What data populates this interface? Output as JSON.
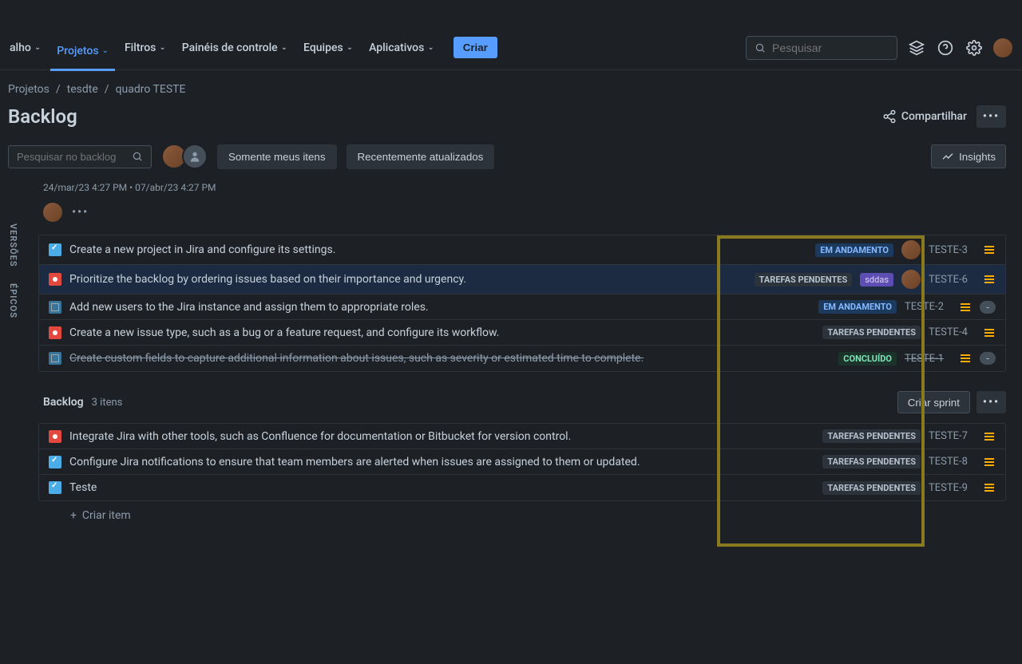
{
  "nav": {
    "truncated": "alho",
    "items": [
      "Projetos",
      "Filtros",
      "Painéis de controle",
      "Equipes",
      "Aplicativos"
    ],
    "create": "Criar",
    "search_placeholder": "Pesquisar"
  },
  "breadcrumb": {
    "items": [
      "Projetos",
      "tesdte",
      "quadro TESTE"
    ]
  },
  "page": {
    "title": "Backlog",
    "share": "Compartilhar"
  },
  "filters": {
    "backlog_search_placeholder": "Pesquisar no backlog",
    "my_items": "Somente meus itens",
    "recent": "Recentemente atualizados",
    "insights": "Insights"
  },
  "side_tabs": {
    "versoes": "VERSÕES",
    "epicos": "ÉPICOS"
  },
  "sprint": {
    "dates": "24/mar/23 4:27 PM  •  07/abr/23 4:27 PM",
    "issues": [
      {
        "type": "task",
        "summary": "Create a new project in Jira and configure its settings.",
        "status": "EM ANDAMENTO",
        "status_class": "andamento",
        "assignee": true,
        "key": "TESTE-3",
        "tag": null,
        "done": false,
        "estimate": null
      },
      {
        "type": "bug",
        "summary": "Prioritize the backlog by ordering issues based on their importance and urgency.",
        "status": "TAREFAS PENDENTES",
        "status_class": "pendente",
        "assignee": true,
        "key": "TESTE-6",
        "tag": "sddas",
        "done": false,
        "selected": true,
        "estimate": null
      },
      {
        "type": "subtask",
        "summary": "Add new users to the Jira instance and assign them to appropriate roles.",
        "status": "EM ANDAMENTO",
        "status_class": "andamento",
        "assignee": false,
        "key": "TESTE-2",
        "tag": null,
        "done": false,
        "estimate": "-"
      },
      {
        "type": "bug",
        "summary": "Create a new issue type, such as a bug or a feature request, and configure its workflow.",
        "status": "TAREFAS PENDENTES",
        "status_class": "pendente",
        "assignee": false,
        "key": "TESTE-4",
        "tag": null,
        "done": false,
        "estimate": null
      },
      {
        "type": "subtask",
        "summary": "Create custom fields to capture additional information about issues, such as severity or estimated time to complete.",
        "status": "CONCLUÍDO",
        "status_class": "concluido",
        "assignee": false,
        "key": "TESTE-1",
        "tag": null,
        "done": true,
        "estimate": "-"
      }
    ]
  },
  "backlog": {
    "title": "Backlog",
    "count": "3 itens",
    "create_sprint": "Criar sprint",
    "create_item": "Criar item",
    "issues": [
      {
        "type": "bug",
        "summary": "Integrate Jira with other tools, such as Confluence for documentation or Bitbucket for version control.",
        "status": "TAREFAS PENDENTES",
        "status_class": "pendente",
        "key": "TESTE-7"
      },
      {
        "type": "task",
        "summary": "Configure Jira notifications to ensure that team members are alerted when issues are assigned to them or updated.",
        "status": "TAREFAS PENDENTES",
        "status_class": "pendente",
        "key": "TESTE-8"
      },
      {
        "type": "task",
        "summary": "Teste",
        "status": "TAREFAS PENDENTES",
        "status_class": "pendente",
        "key": "TESTE-9"
      }
    ]
  }
}
